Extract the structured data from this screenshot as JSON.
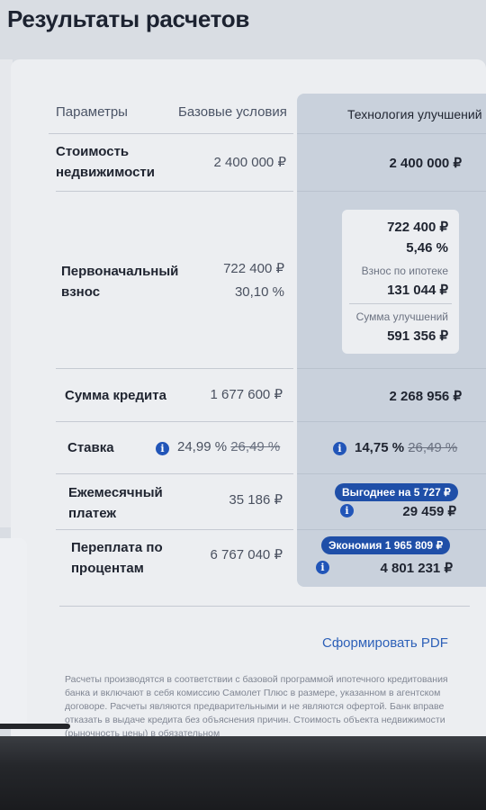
{
  "page": {
    "title": "Результаты расчетов"
  },
  "table": {
    "headers": {
      "params": "Параметры",
      "base": "Базовые условия",
      "tech": "Технология улучшений"
    },
    "rows": {
      "price": {
        "label_line1": "Стоимость",
        "label_line2": "недвижимости",
        "base": "2 400 000 ₽",
        "tech": "2 400 000 ₽"
      },
      "downpayment": {
        "label_line1": "Первоначальный",
        "label_line2": "взнос",
        "base_amount": "722 400 ₽",
        "base_percent": "30,10 %",
        "tech_amount": "722 400 ₽",
        "tech_percent": "5,46 %",
        "tech_mortgage_label": "Взнос по ипотеке",
        "tech_mortgage_value": "131 044 ₽",
        "tech_improvements_label": "Сумма улучшений",
        "tech_improvements_value": "591 356 ₽"
      },
      "loan": {
        "label": "Сумма кредита",
        "base": "1 677 600 ₽",
        "tech": "2 268 956 ₽"
      },
      "rate": {
        "label": "Ставка",
        "base_rate": "24,99 %",
        "base_old_rate": "26,49 %",
        "tech_rate": "14,75 %",
        "tech_old_rate": "26,49 %"
      },
      "monthly": {
        "label_line1": "Ежемесячный",
        "label_line2": "платеж",
        "base": "35 186 ₽",
        "tech_badge": "Выгоднее на 5 727 ₽",
        "tech": "29 459 ₽"
      },
      "overpay": {
        "label_line1": "Переплата по",
        "label_line2": "процентам",
        "base": "6 767 040 ₽",
        "tech_badge": "Экономия 1 965 809 ₽",
        "tech": "4 801 231 ₽"
      }
    }
  },
  "actions": {
    "pdf_link": "Сформировать PDF"
  },
  "disclaimer": "Расчеты производятся в соответствии с базовой программой ипотечного кредитования банка и включают в себя комиссию Самолет Плюс в размере, указанном в агентском договоре. Расчеты являются предварительными и не являются офертой. Банк вправе отказать в выдаче кредита без объяснения причин. Стоимость объекта недвижимости (рыночность цены) в обязательном",
  "icons": {
    "info": "info-icon"
  },
  "colors": {
    "accent": "#1f4fa8",
    "highlight_column": "#c9d1dc",
    "link": "#2d60b8"
  }
}
